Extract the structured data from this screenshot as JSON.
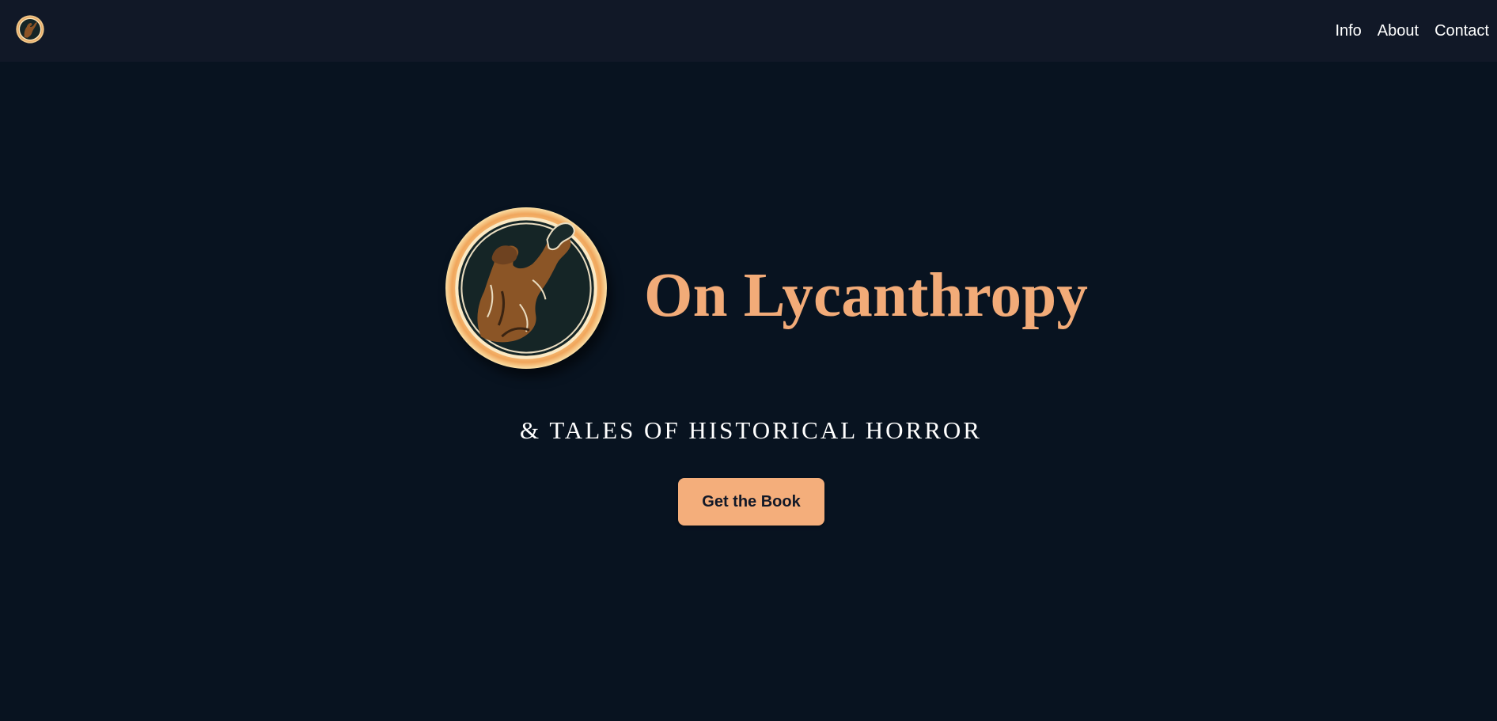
{
  "nav": {
    "logo_icon": "werewolf-emblem-icon",
    "links": [
      {
        "label": "Info"
      },
      {
        "label": "About"
      },
      {
        "label": "Contact"
      }
    ]
  },
  "hero": {
    "emblem_icon": "werewolf-emblem-icon",
    "title": "On Lycanthropy",
    "subtitle": "& TALES OF HISTORICAL HORROR",
    "cta_label": "Get the Book"
  },
  "colors": {
    "page_background": "#081320",
    "topbar_background": "#111827",
    "accent": "#f2ab78",
    "button_background": "#f4ae7b",
    "button_text": "#111827",
    "text": "#ffffff"
  }
}
